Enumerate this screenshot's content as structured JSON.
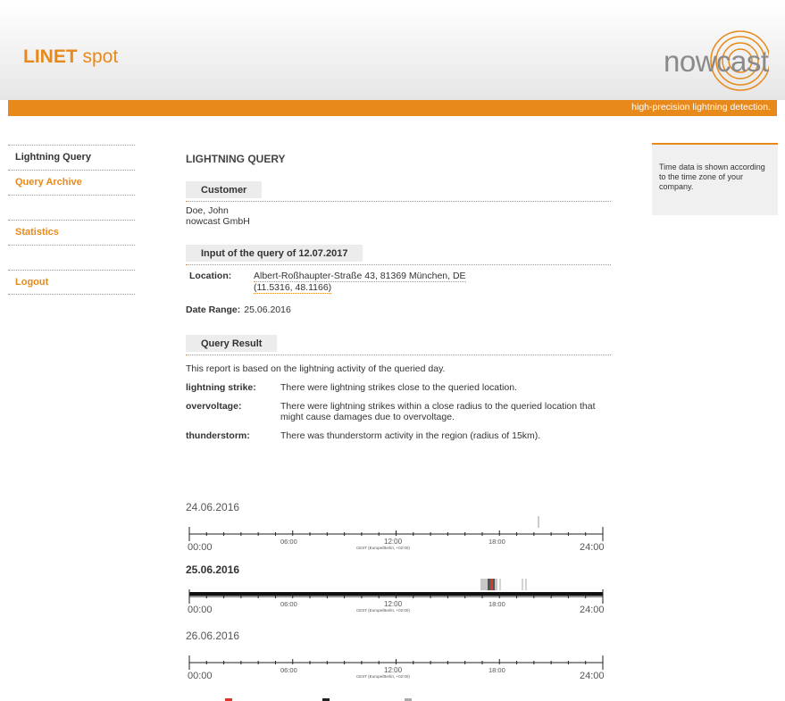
{
  "header": {
    "brand_bold": "LINET",
    "brand_rest": " spot",
    "logo_text": "nowcast",
    "tagline": "high-precision lightning detection."
  },
  "nav": {
    "items": [
      {
        "label": "Lightning Query"
      },
      {
        "label": "Query Archive"
      },
      {
        "label": ""
      },
      {
        "label": "Statistics"
      },
      {
        "label": ""
      },
      {
        "label": "Logout"
      }
    ]
  },
  "main": {
    "title": "LIGHTNING QUERY",
    "customer": {
      "heading": "Customer",
      "name": "Doe, John",
      "company": "nowcast GmbH"
    },
    "input": {
      "heading": "Input of the query of 12.07.2017",
      "location_label": "Location:",
      "location_line1": "Albert-Roßhaupter-Straße 43, 81369 München, DE",
      "location_line2": "(11.5316, 48.1166)",
      "date_label": "Date Range:",
      "date_value": "25.06.2016"
    },
    "result": {
      "heading": "Query Result",
      "intro": "This report is based on the lightning activity of the queried day.",
      "rows": [
        {
          "label": "lightning strike:",
          "text": "There were lightning strikes close to the queried location."
        },
        {
          "label": "overvoltage:",
          "text": "There were lightning strikes within a close radius to the queried location that might cause damages due to overvoltage."
        },
        {
          "label": "thunderstorm:",
          "text": "There was thunderstorm activity in the region (radius of 15km)."
        }
      ]
    }
  },
  "sidebox": {
    "text": "Time data is shown according to the time zone of your company."
  },
  "timelines": [
    {
      "date": "24.06.2016",
      "bold": false
    },
    {
      "date": "25.06.2016",
      "bold": true
    },
    {
      "date": "26.06.2016",
      "bold": false
    }
  ],
  "axis": {
    "start": "00:00",
    "t6": "06:00",
    "t12": "12:00",
    "tz": "CEST (Europe/Berlin, +02:00)",
    "t18": "18:00",
    "end": "24:00"
  },
  "colors": {
    "accent": "#e8891b",
    "lightning_strike": "#d83a2a",
    "overvoltage": "#222222",
    "thunderstorm": "#aaaaaa"
  }
}
